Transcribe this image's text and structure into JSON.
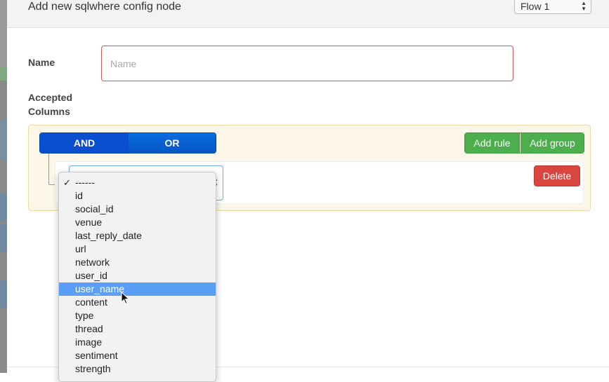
{
  "dialog": {
    "title": "Add new sqlwhere config node",
    "flow_select": {
      "value": "Flow 1"
    }
  },
  "form": {
    "name_label": "Name",
    "name_placeholder": "Name",
    "columns_label_line1": "Accepted",
    "columns_label_line2": "Columns"
  },
  "query_builder": {
    "and_label": "AND",
    "or_label": "OR",
    "add_rule_label": "Add rule",
    "add_group_label": "Add group",
    "delete_label": "Delete"
  },
  "dropdown": {
    "selected_index": 0,
    "highlighted_index": 8,
    "options": [
      "------",
      "id",
      "social_id",
      "venue",
      "last_reply_date",
      "url",
      "network",
      "user_id",
      "user_name",
      "content",
      "type",
      "thread",
      "image",
      "sentiment",
      "strength"
    ]
  },
  "colors": {
    "and_button": "#0b4fd1",
    "or_button": "#0656c4",
    "add_buttons": "#4cae4c",
    "delete_button": "#d9463f",
    "group_background": "#fcf7e8",
    "highlight": "#5a9ff5"
  }
}
